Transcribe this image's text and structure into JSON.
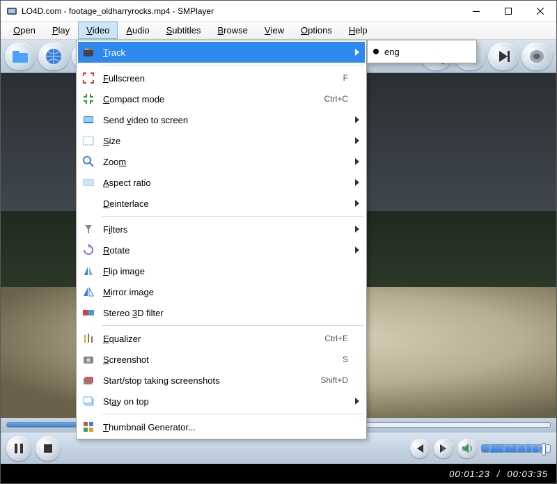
{
  "titlebar": {
    "title": "LO4D.com - footage_oldharryrocks.mp4 - SMPlayer"
  },
  "menubar": {
    "items": [
      {
        "label": "Open",
        "u": "O"
      },
      {
        "label": "Play",
        "u": "P"
      },
      {
        "label": "Video",
        "u": "V"
      },
      {
        "label": "Audio",
        "u": "A"
      },
      {
        "label": "Subtitles",
        "u": "S"
      },
      {
        "label": "Browse",
        "u": "B"
      },
      {
        "label": "View",
        "u": "V"
      },
      {
        "label": "Options",
        "u": "O"
      },
      {
        "label": "Help",
        "u": "H"
      }
    ],
    "active_index": 2
  },
  "video_menu": {
    "items": [
      {
        "id": "track",
        "label": "Track",
        "u": "T",
        "submenu": true,
        "highlight": true
      },
      {
        "sep": true
      },
      {
        "id": "fullscreen",
        "label": "Fullscreen",
        "u": "F",
        "shortcut": "F"
      },
      {
        "id": "compact",
        "label": "Compact mode",
        "u": "C",
        "shortcut": "Ctrl+C"
      },
      {
        "id": "sendvideo",
        "label": "Send video to screen",
        "u": "v",
        "submenu": true
      },
      {
        "id": "size",
        "label": "Size",
        "u": "Si",
        "submenu": true
      },
      {
        "id": "zoom",
        "label": "Zoom",
        "u": "m",
        "submenu": true
      },
      {
        "id": "aspect",
        "label": "Aspect ratio",
        "u": "A",
        "submenu": true
      },
      {
        "id": "deint",
        "label": "Deinterlace",
        "u": "D",
        "submenu": true
      },
      {
        "sep": true
      },
      {
        "id": "filters",
        "label": "Filters",
        "u": "i",
        "submenu": true
      },
      {
        "id": "rotate",
        "label": "Rotate",
        "u": "R",
        "submenu": true
      },
      {
        "id": "flip",
        "label": "Flip image",
        "u": "Fl"
      },
      {
        "id": "mirror",
        "label": "Mirror image",
        "u": "M"
      },
      {
        "id": "stereo3d",
        "label": "Stereo 3D filter",
        "u": "3"
      },
      {
        "sep": true
      },
      {
        "id": "eq",
        "label": "Equalizer",
        "u": "E",
        "shortcut": "Ctrl+E"
      },
      {
        "id": "shot",
        "label": "Screenshot",
        "u": "S",
        "shortcut": "S"
      },
      {
        "id": "shots",
        "label": "Start/stop taking screenshots",
        "shortcut": "Shift+D"
      },
      {
        "id": "stayontop",
        "label": "Stay on top",
        "u": "a",
        "submenu": true
      },
      {
        "sep": true
      },
      {
        "id": "thumbgen",
        "label": "Thumbnail Generator...",
        "u": "T"
      }
    ]
  },
  "track_submenu": {
    "items": [
      {
        "label": "eng",
        "selected": true
      }
    ]
  },
  "playback": {
    "current": "00:01:23",
    "total": "00:03:35",
    "sep": "/"
  },
  "watermark": "LO4D.com",
  "icons": {
    "folder": "folder-icon",
    "globe": "globe-icon",
    "cd": "cd-icon",
    "magnify": "magnify-icon",
    "prev": "skip-prev-icon",
    "next": "skip-next-icon",
    "speaker": "speaker-icon",
    "pause": "pause-icon",
    "stop": "stop-icon",
    "rew": "rewind-icon",
    "fwd": "forward-icon",
    "vol": "volume-icon"
  }
}
